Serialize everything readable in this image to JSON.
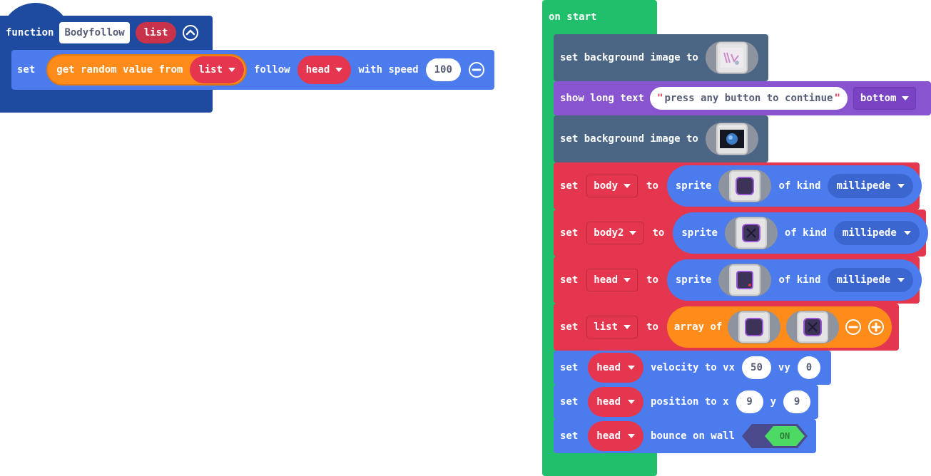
{
  "function_block": {
    "keyword": "function",
    "name": "Bodyfollow",
    "param": "list",
    "set_label": "set",
    "get_random_label": "get random value from",
    "list_dropdown": "list",
    "follow_label": "follow",
    "follow_target": "head",
    "with_speed_label": "with speed",
    "speed": "100"
  },
  "on_start": {
    "label": "on start",
    "set_bg_label": "set background image to",
    "show_long_text_label": "show long text",
    "long_text_value": "press any button to continue",
    "long_text_position": "bottom",
    "set_label": "set",
    "to_label": "to",
    "sprite_label": "sprite",
    "of_kind_label": "of kind",
    "array_of_label": "array of",
    "var_body": "body",
    "var_body2": "body2",
    "var_head": "head",
    "var_list": "list",
    "kind_millipede": "millipede",
    "velocity_label": "velocity to vx",
    "vy_label": "vy",
    "vx": "50",
    "vy": "0",
    "position_label": "position to x",
    "y_label": "y",
    "pos_x": "9",
    "pos_y": "9",
    "bounce_label": "bounce on wall",
    "bounce_toggle": "ON"
  },
  "colors": {
    "function_dark": "#1e4ba0",
    "sprite_blue": "#4b7bec",
    "array_orange": "#ff8c1a",
    "variable_red": "#e4364f",
    "scene_slate": "#4b6584",
    "game_purple": "#8854d0",
    "loop_green": "#20bf6b"
  }
}
